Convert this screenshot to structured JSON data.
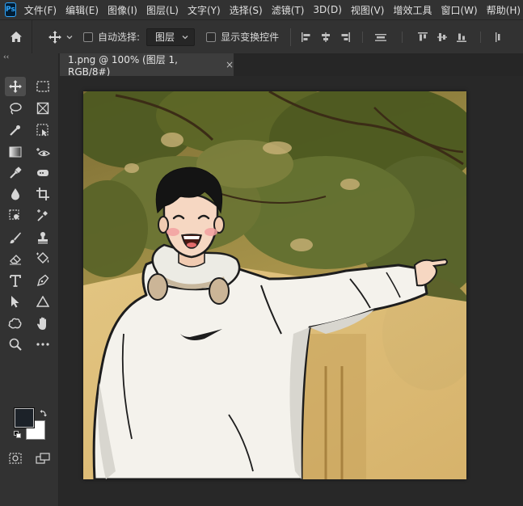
{
  "app": {
    "logo_text": "Ps"
  },
  "menu": {
    "items": [
      "文件(F)",
      "编辑(E)",
      "图像(I)",
      "图层(L)",
      "文字(Y)",
      "选择(S)",
      "滤镜(T)",
      "3D(D)",
      "视图(V)",
      "增效工具",
      "窗口(W)",
      "帮助(H)"
    ]
  },
  "options": {
    "auto_select_label": "自动选择:",
    "auto_select_value": "图层",
    "show_transform_label": "显示变换控件"
  },
  "toolbar": {
    "collapse_glyph": "‹‹"
  },
  "document": {
    "tab_label": "1.png @ 100% (图层 1, RGB/8#)",
    "close_glyph": "×"
  },
  "colors": {
    "foreground": "#1c2229",
    "background": "#ffffff",
    "accent": "#31a8ff"
  }
}
